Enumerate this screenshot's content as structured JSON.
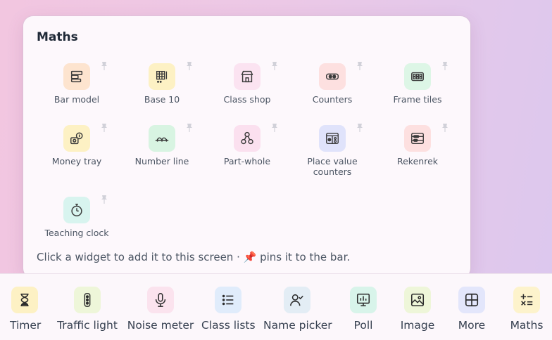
{
  "panel": {
    "title": "Maths",
    "hint_before": "Click a widget to add it to this screen · ",
    "hint_after": " pins it to the bar.",
    "tiles": [
      {
        "label": "Bar model",
        "icon": "bar-model-icon",
        "bg": "#fde4cf"
      },
      {
        "label": "Base 10",
        "icon": "base-10-icon",
        "bg": "#fdf1c4"
      },
      {
        "label": "Class shop",
        "icon": "shop-icon",
        "bg": "#fbe3f1"
      },
      {
        "label": "Counters",
        "icon": "counters-icon",
        "bg": "#fde0e0"
      },
      {
        "label": "Frame tiles",
        "icon": "frame-tiles-icon",
        "bg": "#ddf6e6"
      },
      {
        "label": "Money tray",
        "icon": "money-tray-icon",
        "bg": "#fdf1c4"
      },
      {
        "label": "Number line",
        "icon": "number-line-icon",
        "bg": "#d8f4e2"
      },
      {
        "label": "Part-whole",
        "icon": "part-whole-icon",
        "bg": "#fbe0ef"
      },
      {
        "label": "Place value",
        "label2": "counters",
        "icon": "place-value-icon",
        "bg": "#e0e3fb"
      },
      {
        "label": "Rekenrek",
        "icon": "rekenrek-icon",
        "bg": "#fde0e0"
      },
      {
        "label": "Teaching clock",
        "icon": "clock-icon",
        "bg": "#d8f4ef"
      }
    ]
  },
  "bar": {
    "items": [
      {
        "label": "Timer",
        "icon": "hourglass-icon",
        "bg": "#fdf1c4"
      },
      {
        "label": "Traffic light",
        "icon": "traffic-light-icon",
        "bg": "#eef6d9"
      },
      {
        "label": "Noise meter",
        "icon": "microphone-icon",
        "bg": "#fbe3ee"
      },
      {
        "label": "Class lists",
        "icon": "list-icon",
        "bg": "#e0ecfb"
      },
      {
        "label": "Name picker",
        "icon": "name-picker-icon",
        "bg": "#e3edf5"
      },
      {
        "label": "Poll",
        "icon": "poll-icon",
        "bg": "#d8f4ea"
      },
      {
        "label": "Image",
        "icon": "image-icon",
        "bg": "#eef6d9"
      },
      {
        "label": "More",
        "icon": "grid-icon",
        "bg": "#e3e6fb"
      },
      {
        "label": "Maths",
        "icon": "maths-icon",
        "bg": "#fdf3cc"
      }
    ]
  }
}
